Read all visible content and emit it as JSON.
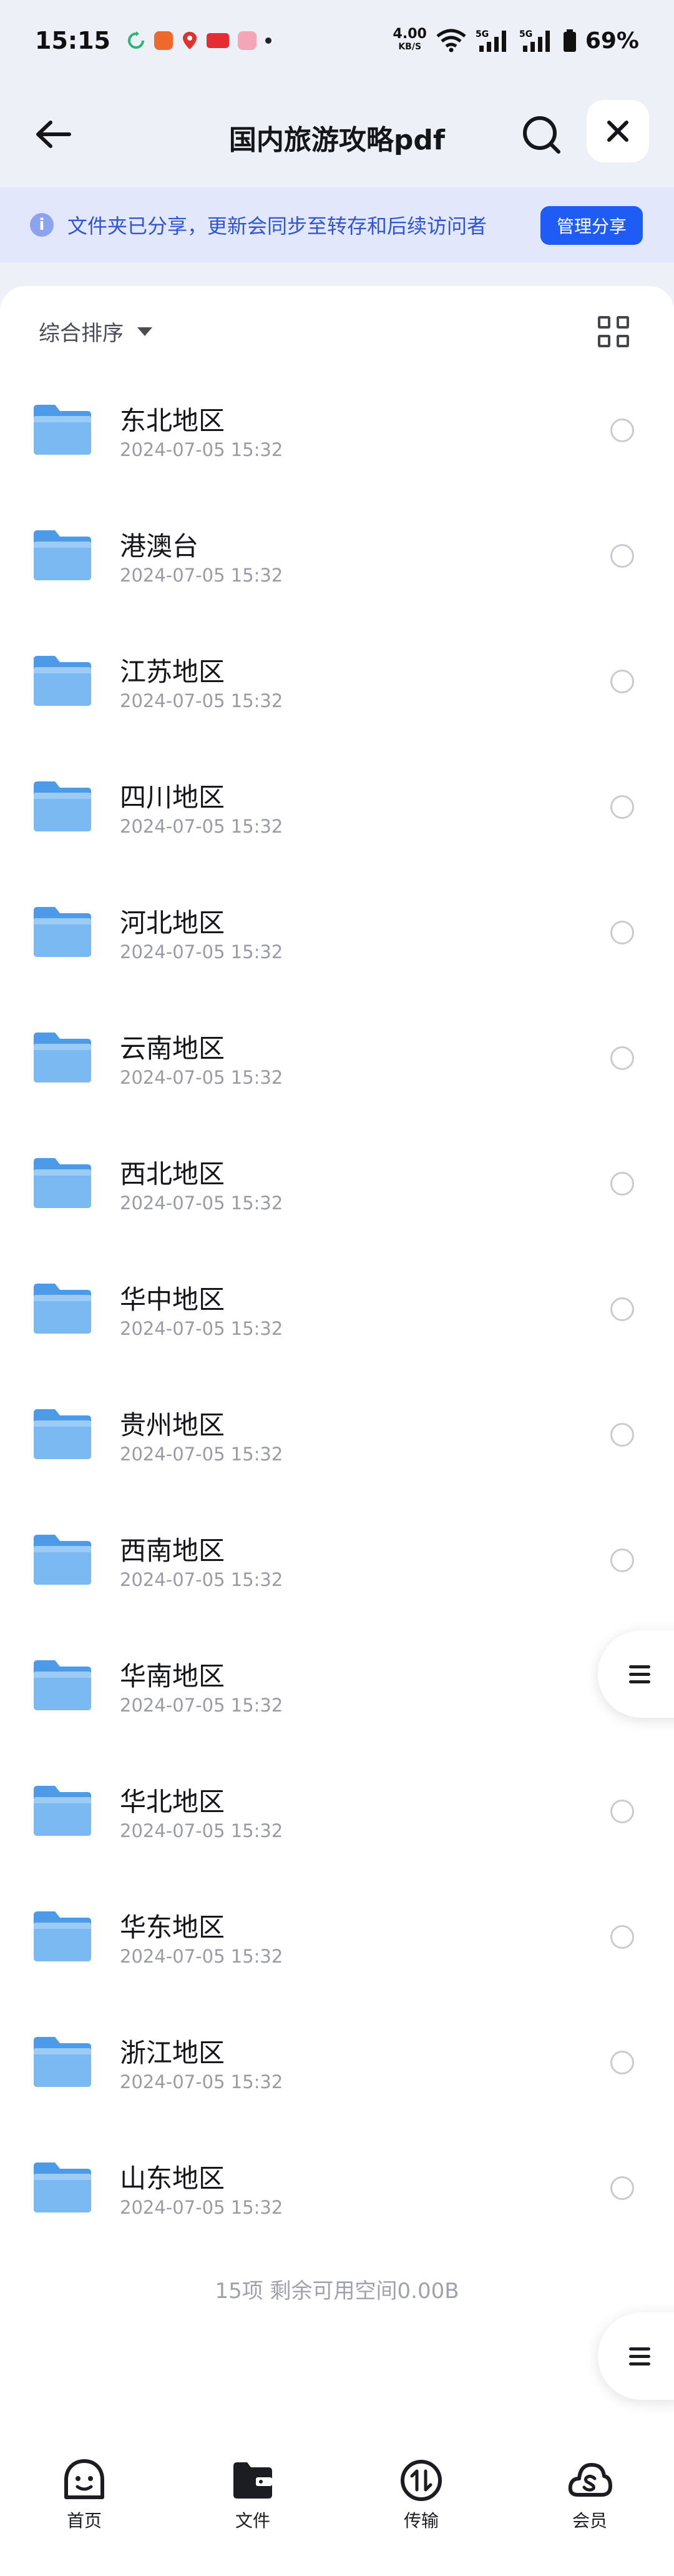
{
  "status_bar": {
    "time": "15:15",
    "speed_value": "4.00",
    "speed_unit": "KB/S",
    "battery": "69%"
  },
  "header": {
    "title": "国内旅游攻略pdf"
  },
  "banner": {
    "text": "文件夹已分享，更新会同步至转存和后续访问者",
    "button_label": "管理分享"
  },
  "toolbar": {
    "sort_label": "综合排序"
  },
  "folders": [
    {
      "name": "东北地区",
      "date": "2024-07-05 15:32"
    },
    {
      "name": "港澳台",
      "date": "2024-07-05 15:32"
    },
    {
      "name": "江苏地区",
      "date": "2024-07-05 15:32"
    },
    {
      "name": "四川地区",
      "date": "2024-07-05 15:32"
    },
    {
      "name": "河北地区",
      "date": "2024-07-05 15:32"
    },
    {
      "name": "云南地区",
      "date": "2024-07-05 15:32"
    },
    {
      "name": "西北地区",
      "date": "2024-07-05 15:32"
    },
    {
      "name": "华中地区",
      "date": "2024-07-05 15:32"
    },
    {
      "name": "贵州地区",
      "date": "2024-07-05 15:32"
    },
    {
      "name": "西南地区",
      "date": "2024-07-05 15:32"
    },
    {
      "name": "华南地区",
      "date": "2024-07-05 15:32"
    },
    {
      "name": "华北地区",
      "date": "2024-07-05 15:32"
    },
    {
      "name": "华东地区",
      "date": "2024-07-05 15:32"
    },
    {
      "name": "浙江地区",
      "date": "2024-07-05 15:32"
    },
    {
      "name": "山东地区",
      "date": "2024-07-05 15:32"
    }
  ],
  "summary": "15项 剩余可用空间0.00B",
  "nav": [
    {
      "label": "首页",
      "icon": "home-icon"
    },
    {
      "label": "文件",
      "icon": "files-icon"
    },
    {
      "label": "传输",
      "icon": "transfer-icon"
    },
    {
      "label": "会员",
      "icon": "vip-icon"
    }
  ],
  "colors": {
    "accent": "#1f5cf5",
    "banner_bg": "#e2e7fb",
    "banner_text": "#2f55d4",
    "folder": "#5aa5ee"
  }
}
